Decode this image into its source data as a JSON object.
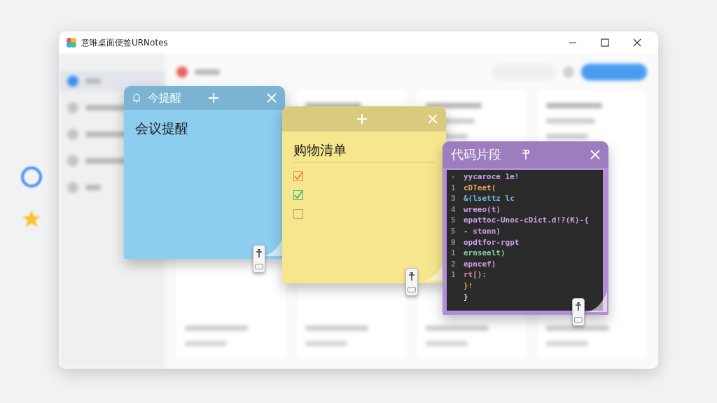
{
  "window": {
    "title": "意唯桌面便签URNotes"
  },
  "sidebar": {
    "items": [
      {
        "selected": true
      },
      {
        "selected": false
      },
      {
        "selected": false
      },
      {
        "selected": false
      },
      {
        "selected": false
      }
    ]
  },
  "notes": [
    {
      "kind": "reminder",
      "color": "#8ccdf0",
      "header": "今提醒",
      "title": "会议提醒"
    },
    {
      "kind": "checklist",
      "color": "#f6e78e",
      "title": "购物清单",
      "items": [
        {
          "checked": true,
          "color": "#e8863a"
        },
        {
          "checked": true,
          "color": "#45b57a"
        },
        {
          "checked": false,
          "color": "#c49a6c"
        }
      ]
    },
    {
      "kind": "code",
      "color": "#b38ed8",
      "title": "代码片段",
      "lines": [
        {
          "number": "‹",
          "code": "yycaroce 1e!",
          "color": "#c9a0e8"
        },
        {
          "number": "1",
          "code": "cDTeet(",
          "color": "#e8a05a"
        },
        {
          "number": "3",
          "code": "&(lsettz lc",
          "color": "#6fb8e0"
        },
        {
          "number": "4",
          "code": "wreeo(t)",
          "color": "#d49ae0"
        },
        {
          "number": "5",
          "code": "epattoc-Unoc-cDict.d!?(K)-{",
          "color": "#c9a0e8"
        },
        {
          "number": "5",
          "code": "- stonn)",
          "color": "#d49ae0"
        },
        {
          "number": "9",
          "code": "opdtfor-rgpt",
          "color": "#c9a0e8"
        },
        {
          "number": "1",
          "code": "ernseelt)",
          "color": "#7fd0a0"
        },
        {
          "number": "2",
          "code": "epncef)",
          "color": "#d49ae0"
        },
        {
          "number": "1",
          "code": "rt[):",
          "color": "#e08aa8"
        },
        {
          "code": "}!",
          "color": "#f0a040"
        },
        {
          "code": "}",
          "color": "#dddddd"
        }
      ]
    }
  ]
}
